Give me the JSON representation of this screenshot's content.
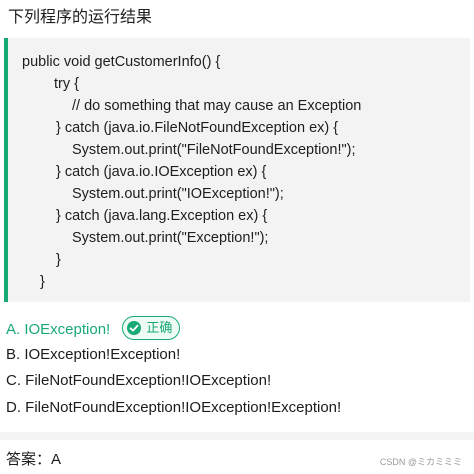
{
  "question": {
    "title": "下列程序的运行结果"
  },
  "code": {
    "lines": [
      "public void getCustomerInfo() {",
      "try {",
      "// do something that may cause an Exception",
      "} catch (java.io.FileNotFoundException ex) {",
      "System.out.print(\"FileNotFoundException!\");",
      "} catch (java.io.IOException ex) {",
      "System.out.print(\"IOException!\");",
      "} catch (java.lang.Exception ex) {",
      "System.out.print(\"Exception!\");",
      "}",
      "}"
    ]
  },
  "options": [
    {
      "text": "A. IOException!",
      "correct": true
    },
    {
      "text": "B. IOException!Exception!",
      "correct": false
    },
    {
      "text": "C. FileNotFoundException!IOException!",
      "correct": false
    },
    {
      "text": "D. FileNotFoundException!IOException!Exception!",
      "correct": false
    }
  ],
  "badge": {
    "label": "正确",
    "icon": "check-circle-icon",
    "color": "#19a974"
  },
  "answer": {
    "text": "答案：A"
  },
  "watermark": {
    "text": "CSDN @ミカミミミ"
  },
  "colors": {
    "accent": "#19a974",
    "code_background": "#f3f3f3"
  }
}
